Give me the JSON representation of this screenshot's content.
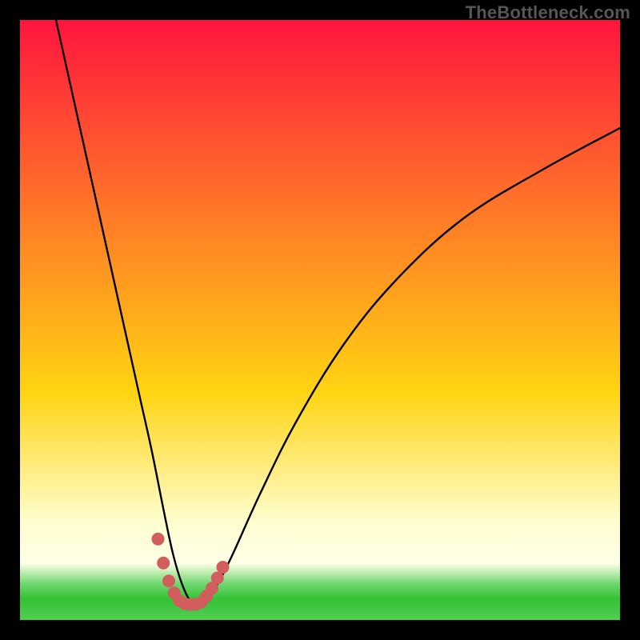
{
  "attribution": "TheBottleneck.com",
  "colors": {
    "frame_bg": "#000000",
    "gradient_top": "#ff153e",
    "gradient_mid": "#ffd412",
    "gradient_pale1": "#fffed1",
    "gradient_pale2": "#ffffe7",
    "gradient_green1": "#6fd76f",
    "gradient_green2": "#34c234",
    "gradient_green3": "#51ce51",
    "curve_stroke": "#000000",
    "dots_fill": "#d15d5d"
  },
  "chart_data": {
    "type": "line",
    "title": "",
    "xlabel": "",
    "ylabel": "",
    "xlim": [
      0,
      100
    ],
    "ylim": [
      0,
      100
    ],
    "series": [
      {
        "name": "bottleneck-curve",
        "x": [
          6,
          8,
          10,
          12,
          14,
          16,
          18,
          20,
          22,
          24,
          25.5,
          27,
          28.5,
          30,
          32,
          35,
          40,
          46,
          54,
          63,
          74,
          87,
          100
        ],
        "values": [
          100,
          91,
          82,
          73,
          64,
          55,
          46,
          37,
          28,
          18,
          11,
          6,
          3,
          2.5,
          4.5,
          10,
          21,
          33,
          46,
          57,
          67,
          75,
          82
        ]
      }
    ],
    "dots": {
      "name": "highlight-dots",
      "x": [
        23.0,
        23.9,
        24.8,
        25.7,
        26.6,
        27.5,
        28.4,
        29.3,
        30.2,
        31.1,
        32.0,
        32.9,
        33.8
      ],
      "values": [
        13.5,
        9.5,
        6.5,
        4.5,
        3.2,
        2.7,
        2.6,
        2.6,
        3.0,
        4.0,
        5.3,
        7.0,
        8.8
      ],
      "radius": 8
    }
  }
}
